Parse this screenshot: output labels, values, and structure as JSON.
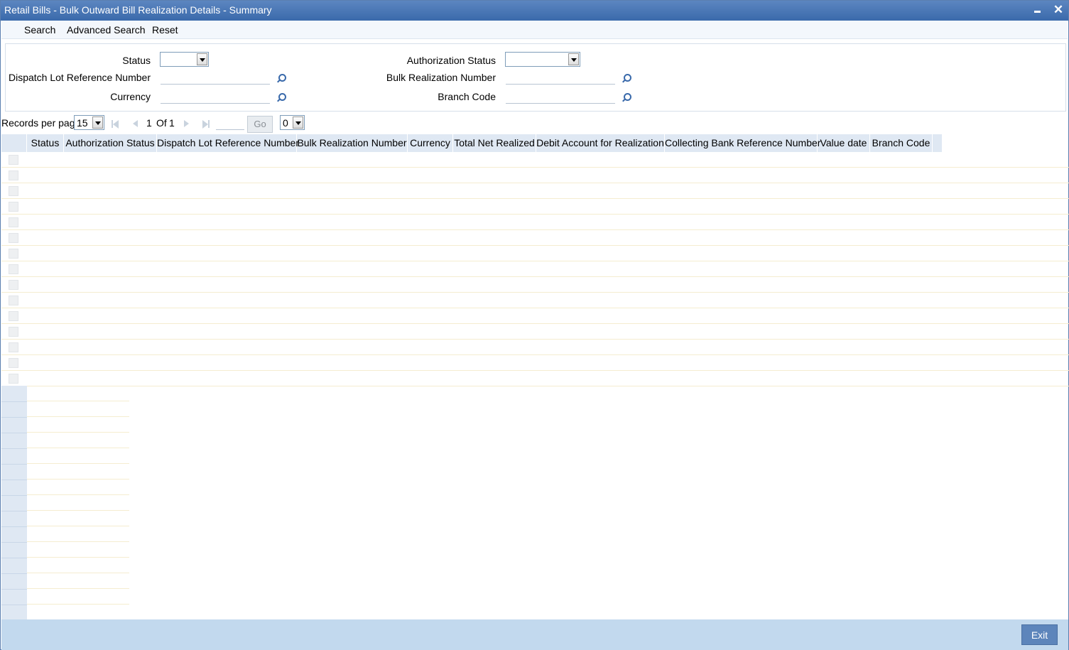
{
  "window": {
    "title": "Retail Bills - Bulk Outward Bill Realization Details - Summary"
  },
  "toolbar": {
    "search": "Search",
    "advanced_search": "Advanced Search",
    "reset": "Reset"
  },
  "criteria": {
    "status_label": "Status",
    "status_value": "",
    "auth_status_label": "Authorization Status",
    "auth_status_value": "",
    "dispatch_lot_label": "Dispatch Lot Reference Number",
    "dispatch_lot_value": "",
    "bulk_realization_label": "Bulk Realization Number",
    "bulk_realization_value": "",
    "currency_label": "Currency",
    "currency_value": "",
    "branch_code_label": "Branch Code",
    "branch_code_value": ""
  },
  "pager": {
    "records_per_page_label": "Records per page",
    "records_per_page_value": "15",
    "current_page": "1",
    "of_label": "Of",
    "total_pages": "1",
    "go_label": "Go",
    "extra_select_value": "0"
  },
  "grid": {
    "columns": [
      "Status",
      "Authorization Status",
      "Dispatch Lot Reference Number",
      "Bulk Realization Number",
      "Currency",
      "Total Net Realized",
      "Debit Account for Realization",
      "Collecting Bank Reference Number",
      "Value date",
      "Branch Code"
    ],
    "rows": [],
    "visible_empty_rows": 15
  },
  "footer": {
    "exit": "Exit"
  }
}
